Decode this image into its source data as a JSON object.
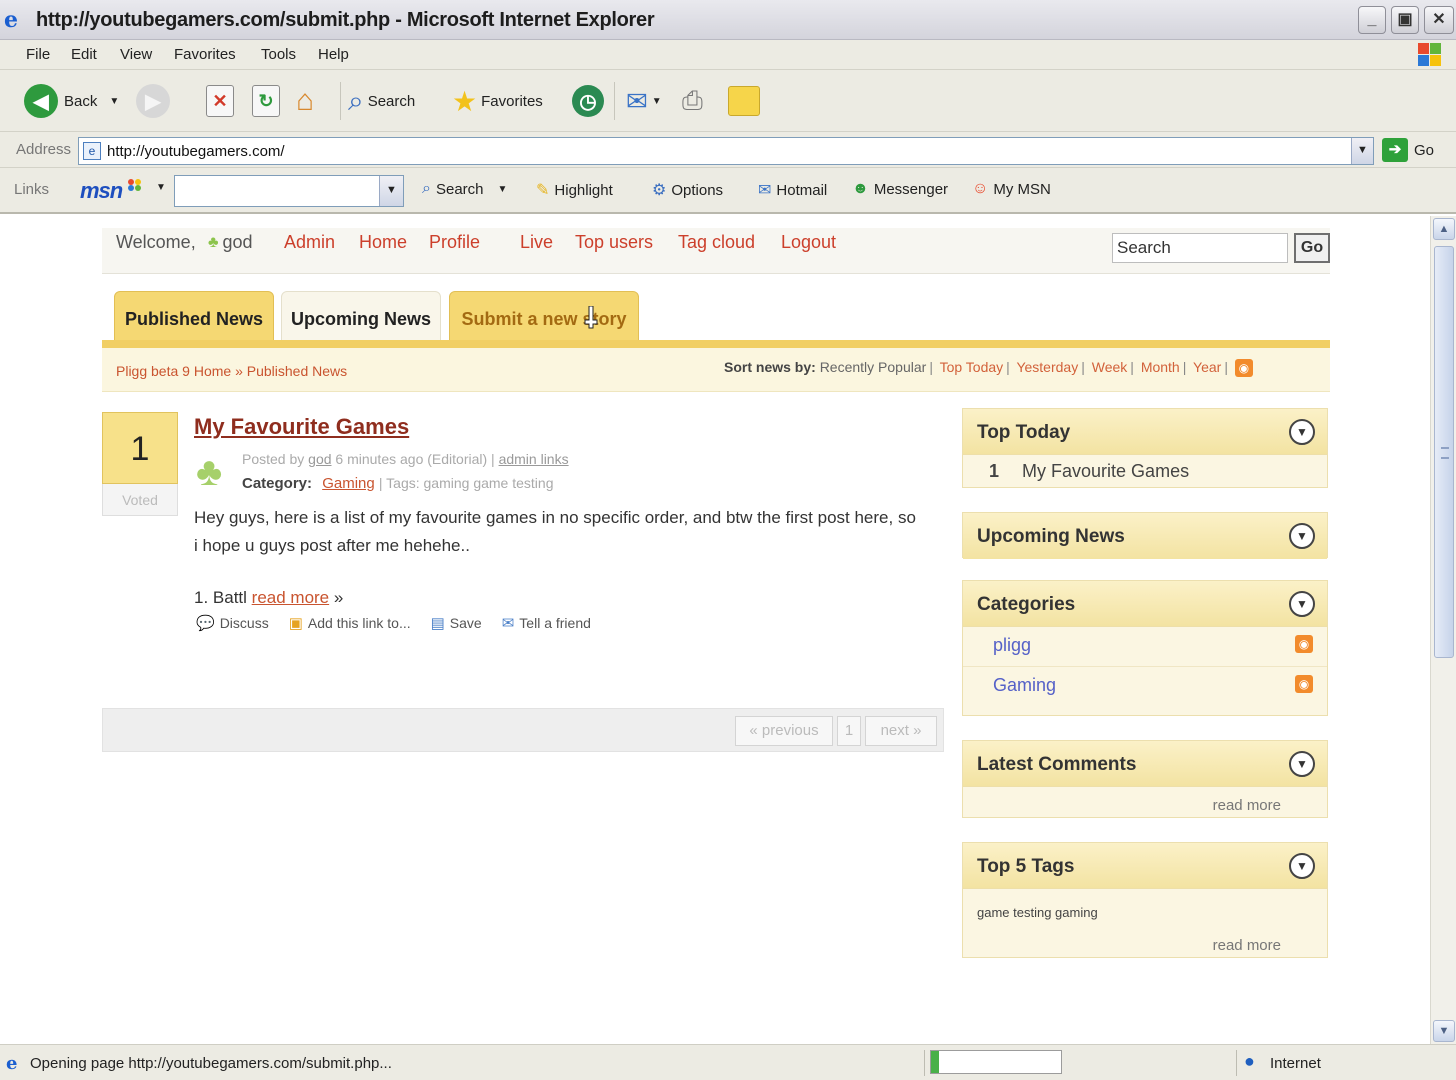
{
  "window": {
    "title": "http://youtubegamers.com/submit.php - Microsoft Internet Explorer",
    "controls": {
      "minimize": "_",
      "maximize": "▣",
      "close": "✕"
    }
  },
  "menu": [
    "File",
    "Edit",
    "View",
    "Favorites",
    "Tools",
    "Help"
  ],
  "toolbar": {
    "back": "Back",
    "search": "Search",
    "favorites": "Favorites"
  },
  "address": {
    "label": "Address",
    "url": "http://youtubegamers.com/",
    "go": "Go"
  },
  "links_bar": {
    "label": "Links",
    "msn_logo": "msn",
    "search": "Search",
    "highlight": "Highlight",
    "options": "Options",
    "hotmail": "Hotmail",
    "messenger": "Messenger",
    "my_msn": "My MSN"
  },
  "site_nav": {
    "welcome": "Welcome,",
    "username": "god",
    "links": [
      "Admin",
      "Home",
      "Profile",
      "Live",
      "Top users",
      "Tag cloud",
      "Logout"
    ],
    "search_value": "Search",
    "search_go": "Go"
  },
  "tabs": [
    "Published News",
    "Upcoming News",
    "Submit a new story"
  ],
  "breadcrumb": "Pligg beta 9 Home » Published News",
  "sort": {
    "label": "Sort news by:",
    "options": [
      "Recently Popular",
      "Top Today",
      "Yesterday",
      "Week",
      "Month",
      "Year"
    ]
  },
  "story": {
    "votes": "1",
    "voted_label": "Voted",
    "title": "My Favourite Games",
    "meta_prefix": "Posted by",
    "author": "god",
    "meta_suffix": "6 minutes ago (Editorial) |",
    "admin_links": "admin links",
    "category_label": "Category:",
    "category": "Gaming",
    "tags": "| Tags: gaming game testing",
    "body": "Hey guys, here is a list of my favourite games in no specific order, and btw the first post here, so i hope u guys post after me hehehe..",
    "more_prefix": "1. Battl",
    "read_more": "read more",
    "more_suffix": "»",
    "actions": [
      "Discuss",
      "Add this link to...",
      "Save",
      "Tell a friend"
    ]
  },
  "pagination": {
    "previous": "« previous",
    "page": "1",
    "next": "next »"
  },
  "sidebar": {
    "top_today": {
      "title": "Top Today",
      "rank": "1",
      "item": "My Favourite Games"
    },
    "upcoming": {
      "title": "Upcoming News"
    },
    "categories": {
      "title": "Categories",
      "items": [
        "pligg",
        "Gaming"
      ]
    },
    "latest_comments": {
      "title": "Latest Comments",
      "read_more": "read more"
    },
    "top_tags": {
      "title": "Top 5 Tags",
      "tags": "game testing gaming",
      "read_more": "read more"
    }
  },
  "status_bar": {
    "text": "Opening page http://youtubegamers.com/submit.php...",
    "zone": "Internet"
  },
  "colors": {
    "tab_active": "#f5d873",
    "link_red": "#cc3f2b",
    "title_brown": "#8f2d1e",
    "category_blue": "#5561c8"
  }
}
